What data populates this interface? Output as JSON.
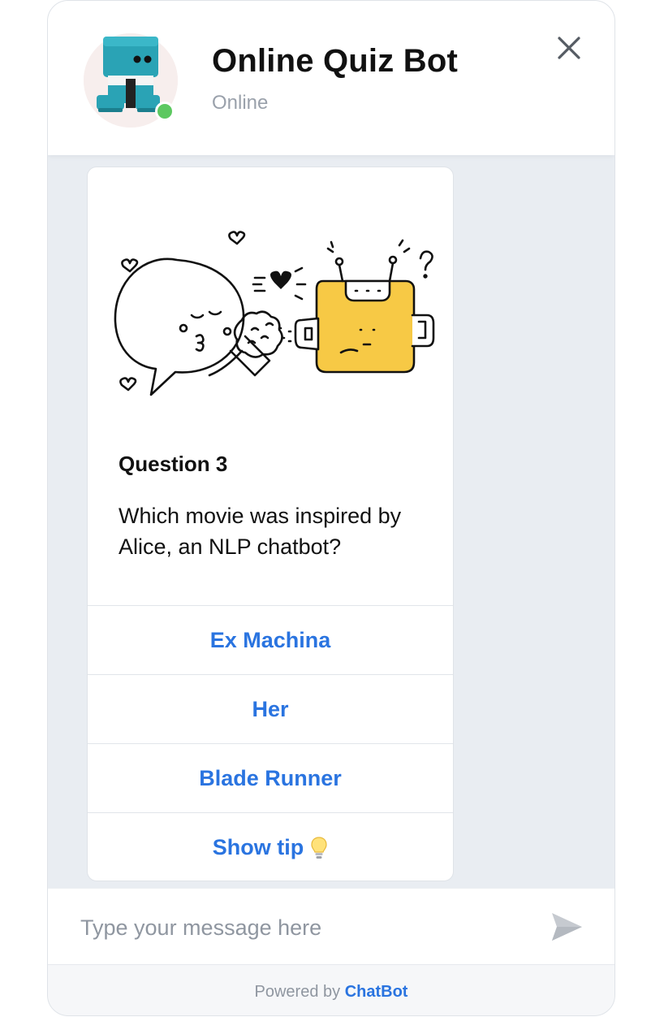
{
  "header": {
    "bot_name": "Online Quiz Bot",
    "status": "Online",
    "status_color": "#5cc860"
  },
  "icons": {
    "close": "close-icon",
    "send": "send-icon",
    "bulb": "lightbulb-icon"
  },
  "card": {
    "question_title": "Question 3",
    "question_text": "Which movie was inspired by Alice, an NLP chatbot?",
    "options": [
      {
        "label": "Ex Machina"
      },
      {
        "label": "Her"
      },
      {
        "label": "Blade Runner"
      },
      {
        "label": "Show tip"
      }
    ]
  },
  "composer": {
    "placeholder": "Type your message here"
  },
  "footer": {
    "prefix": "Powered by",
    "brand": "ChatBot"
  },
  "colors": {
    "accent": "#2a74e0",
    "chat_background": "#e9edf2",
    "robot_yellow": "#f7c945",
    "robot_teal": "#2aa3b5"
  }
}
